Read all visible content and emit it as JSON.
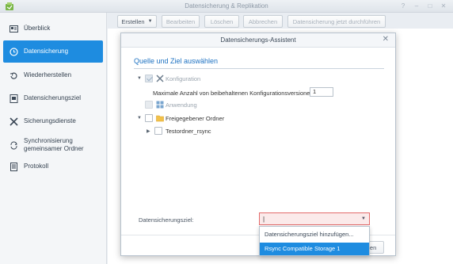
{
  "window": {
    "title": "Datensicherung & Replikation",
    "controls": [
      "?",
      "–",
      "□",
      "✕"
    ]
  },
  "sidebar": {
    "items": [
      {
        "label": "Überblick",
        "icon": "overview-icon"
      },
      {
        "label": "Datensicherung",
        "icon": "backup-clock-icon",
        "active": true
      },
      {
        "label": "Wiederherstellen",
        "icon": "restore-icon"
      },
      {
        "label": "Datensicherungsziel",
        "icon": "target-icon"
      },
      {
        "label": "Sicherungsdienste",
        "icon": "tools-icon"
      },
      {
        "label_line1": "Synchronisierung",
        "label_line2": "gemeinsamer Ordner",
        "icon": "sync-icon"
      },
      {
        "label": "Protokoll",
        "icon": "log-icon"
      }
    ]
  },
  "toolbar": {
    "create": "Erstellen",
    "edit": "Bearbeiten",
    "delete": "Löschen",
    "cancel": "Abbrechen",
    "run_now": "Datensicherung jetzt durchführen"
  },
  "dialog": {
    "title": "Datensicherungs-Assistent",
    "section_title": "Quelle und Ziel auswählen",
    "tree": {
      "configuration": "Konfiguration",
      "max_versions_label": "Maximale Anzahl von beibehaltenen Konfigurationsversionen",
      "max_versions_value": "1",
      "application": "Anwendung",
      "shared_folder": "Freigegebener Ordner",
      "test_folder": "Testordner_rsync"
    },
    "target_label": "Datensicherungsziel:",
    "target_value": "|",
    "dropdown": {
      "options": [
        "Datensicherungsziel hinzufügen...",
        "Rsync Compatible Storage 1"
      ],
      "selected_index": 1
    },
    "partial_button": "hen"
  },
  "colors": {
    "accent": "#1e8ce0",
    "section_title": "#1c71c2",
    "error_border": "#e36b6b"
  }
}
